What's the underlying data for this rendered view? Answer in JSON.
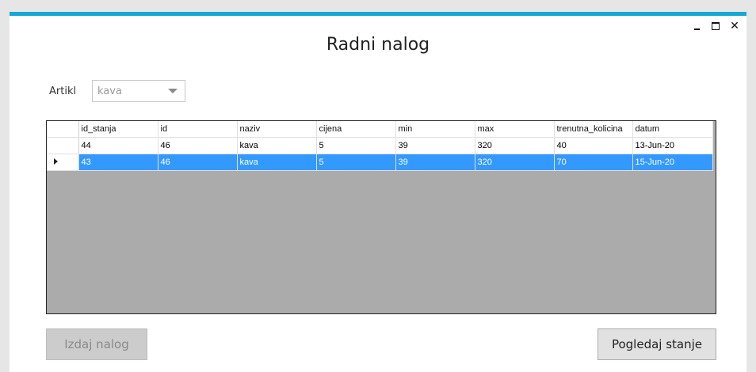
{
  "window": {
    "title": "Radni nalog",
    "controls": {
      "minimize": "minimize-icon",
      "maximize": "maximize-icon",
      "close": "close-icon"
    }
  },
  "filter": {
    "label": "Artikl",
    "selected": "kava"
  },
  "grid": {
    "columns": [
      "id_stanja",
      "id",
      "naziv",
      "cijena",
      "min",
      "max",
      "trenutna_kolicina",
      "datum"
    ],
    "rows": [
      [
        "44",
        "46",
        "kava",
        "5",
        "39",
        "320",
        "40",
        "13-Jun-20"
      ],
      [
        "43",
        "46",
        "kava",
        "5",
        "39",
        "320",
        "70",
        "15-Jun-20"
      ]
    ],
    "selected_row": 1
  },
  "buttons": {
    "izdaj": "Izdaj nalog",
    "pogledaj": "Pogledaj stanje"
  },
  "colors": {
    "accent": "#15a8d6",
    "selection": "#3399ff",
    "grid_background": "#ababab"
  }
}
